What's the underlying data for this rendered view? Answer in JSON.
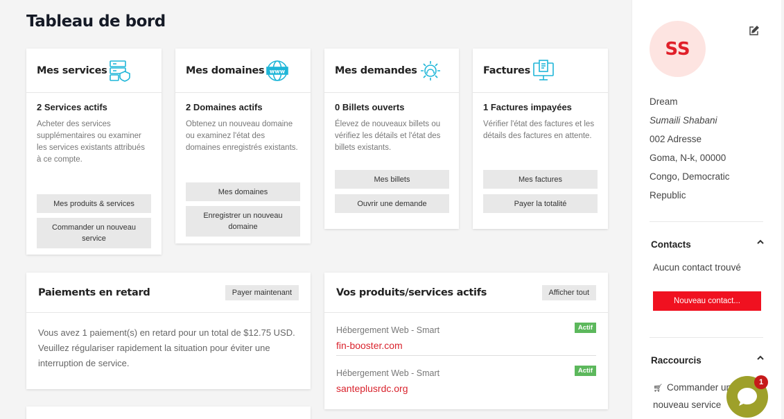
{
  "page": {
    "title": "Tableau de bord"
  },
  "colors": {
    "accent": "#d9232d",
    "icon_teal": "#1fb6d8",
    "badge_green": "#5cb85c",
    "chat": "#9ea02a"
  },
  "cards": [
    {
      "title": "Mes services",
      "icon": "server-shield-icon",
      "subtitle": "2 Services actifs",
      "desc": "Acheter des services supplémentaires ou examiner les services existants attribués à ce compte.",
      "buttons": [
        "Mes produits & services",
        "Commander un nouveau service"
      ]
    },
    {
      "title": "Mes domaines",
      "icon": "www-globe-icon",
      "subtitle": "2 Domaines actifs",
      "desc": "Obtenez un nouveau domaine ou examinez l'état des domaines enregistrés existants.",
      "buttons": [
        "Mes domaines",
        "Enregistrer un nouveau domaine"
      ]
    },
    {
      "title": "Mes demandes",
      "icon": "gear-support-icon",
      "subtitle": "0 Billets ouverts",
      "desc": "Élevez de nouveaux billets ou vérifiez les détails et l'état des billets existants.",
      "buttons": [
        "Mes billets",
        "Ouvrir une demande"
      ]
    },
    {
      "title": "Factures",
      "icon": "invoice-monitor-icon",
      "subtitle": "1 Factures impayées",
      "desc": "Vérifier l'état des factures et les détails des factures en attente.",
      "buttons": [
        "Mes factures",
        "Payer la totalité"
      ]
    }
  ],
  "late": {
    "title": "Paiements en retard",
    "button": "Payer maintenant",
    "text": "Vous avez 1 paiement(s) en retard pour un total de $12.75 USD. Veuillez régulariser rapidement la situation pour éviter une interruption de service."
  },
  "products": {
    "title": "Vos produits/services actifs",
    "button": "Afficher tout",
    "items": [
      {
        "name": "Hébergement Web - Smart",
        "domain": "fin-booster.com",
        "status": "Actif"
      },
      {
        "name": "Hébergement Web - Smart",
        "domain": "santeplusrdc.org",
        "status": "Actif"
      }
    ]
  },
  "sidebar": {
    "avatar": "SS",
    "address": [
      "Dream",
      "Sumaili Shabani",
      "002 Adresse",
      "Goma, N-k, 00000",
      "Congo, Democratic",
      "Republic"
    ],
    "contacts": {
      "title": "Contacts",
      "empty": "Aucun contact trouvé",
      "button": "Nouveau contact..."
    },
    "shortcuts": {
      "title": "Raccourcis",
      "item_line1": "Commander un",
      "item_line2": "nouveau service"
    }
  },
  "chat": {
    "badge": "1"
  }
}
